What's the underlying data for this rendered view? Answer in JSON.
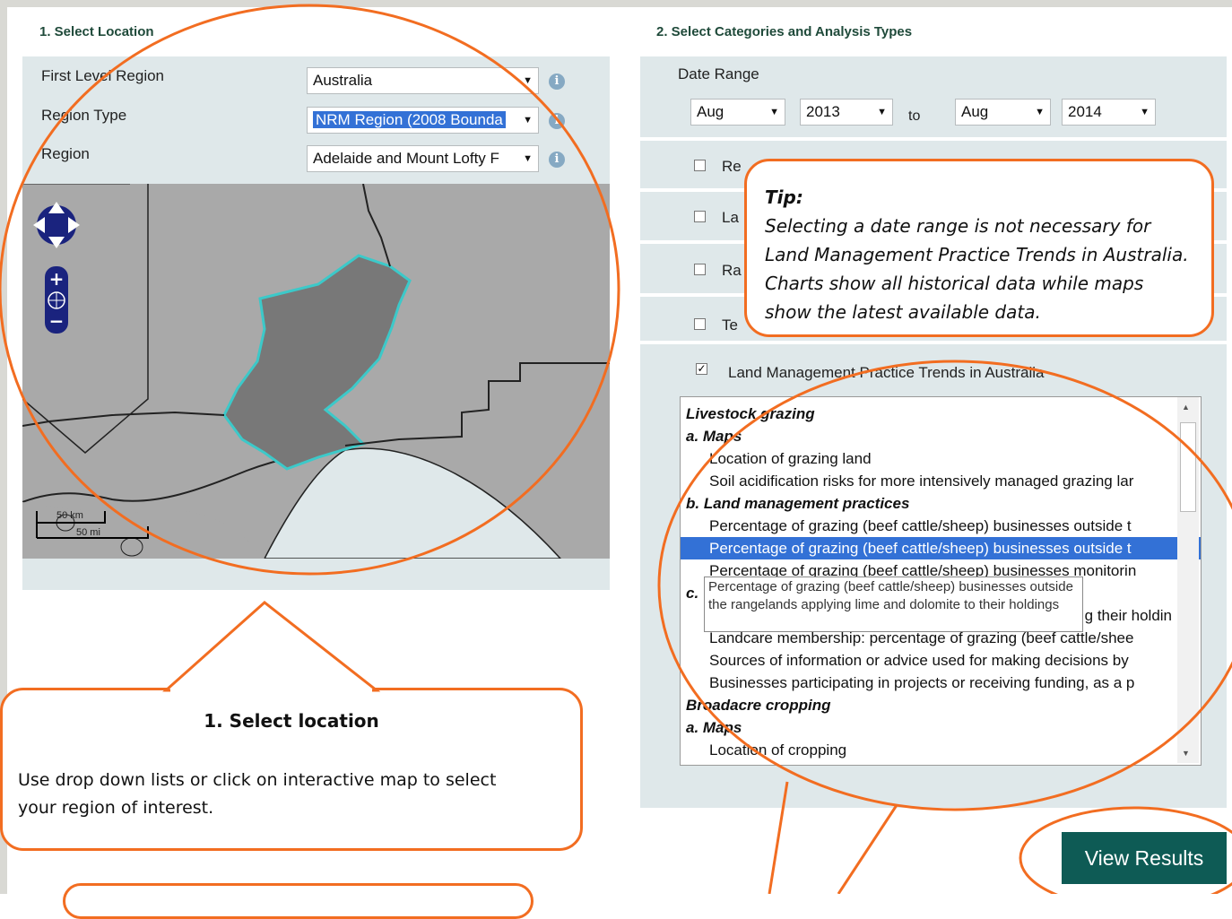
{
  "section1": {
    "title": "1. Select Location"
  },
  "section2": {
    "title": "2. Select Categories and Analysis Types"
  },
  "location": {
    "first_level_label": "First Level Region",
    "first_level_value": "Australia",
    "region_type_label": "Region Type",
    "region_type_value": "NRM Region (2008 Bounda",
    "region_label": "Region",
    "region_value": "Adelaide and Mount Lofty F"
  },
  "map": {
    "scale_km": "50 km",
    "scale_mi": "50 mi",
    "colors": {
      "background": "#a9a9a9",
      "selected_region": "#787878",
      "selected_outline": "#3cc9c9",
      "sea": "#dfe8ea"
    },
    "icons": [
      "pan-up-icon",
      "pan-left-icon",
      "pan-right-icon",
      "pan-down-icon",
      "zoom-in-icon",
      "zoom-world-icon",
      "zoom-out-icon"
    ]
  },
  "date_range": {
    "label": "Date Range",
    "from_month": "Aug",
    "from_year": "2013",
    "to_label": "to",
    "to_month": "Aug",
    "to_year": "2014"
  },
  "categories": [
    {
      "label": "Re",
      "checked": false
    },
    {
      "label": "La",
      "checked": false
    },
    {
      "label": "Ra",
      "checked": false
    },
    {
      "label": "Te",
      "checked": false
    },
    {
      "label": "Land Management Practice Trends in Australia",
      "checked": true
    }
  ],
  "tip": {
    "heading": "Tip:",
    "body": "Selecting a date range is not necessary for Land Management Practice Trends in Australia. Charts show all historical data while maps show the latest available data."
  },
  "analysis_list": [
    {
      "text": "Livestock grazing",
      "kind": "heading"
    },
    {
      "text": "a. Maps",
      "kind": "heading"
    },
    {
      "text": "Location of grazing land",
      "kind": "item"
    },
    {
      "text": "Soil acidification risks for more intensively managed grazing lar",
      "kind": "item"
    },
    {
      "text": "b. Land management practices",
      "kind": "heading"
    },
    {
      "text": "Percentage of grazing (beef cattle/sheep) businesses outside t",
      "kind": "item"
    },
    {
      "text": "Percentage of grazing (beef cattle/sheep) businesses outside t",
      "kind": "item",
      "selected": true
    },
    {
      "text": "Percentage of grazing (beef cattle/sheep) businesses monitorin",
      "kind": "item"
    },
    {
      "text": "c.",
      "kind": "heading"
    },
    {
      "text": "g their holdin",
      "kind": "item"
    },
    {
      "text": "Landcare membership: percentage of grazing (beef cattle/shee",
      "kind": "item"
    },
    {
      "text": "Sources of information or advice used for making decisions by",
      "kind": "item"
    },
    {
      "text": "Businesses participating in projects or receiving funding, as a p",
      "kind": "item"
    },
    {
      "text": "Broadacre cropping",
      "kind": "heading"
    },
    {
      "text": "a. Maps",
      "kind": "heading"
    },
    {
      "text": "Location of cropping",
      "kind": "item"
    }
  ],
  "tooltip_text": "Percentage of grazing (beef cattle/sheep) businesses outside the rangelands applying lime and dolomite to their holdings",
  "callout_location": {
    "heading": "1. Select location",
    "body": "Use drop down lists or click on interactive map to select your region of interest."
  },
  "view_results_label": "View Results",
  "accent_color": "#f26d21",
  "button_color": "#0e5b55"
}
